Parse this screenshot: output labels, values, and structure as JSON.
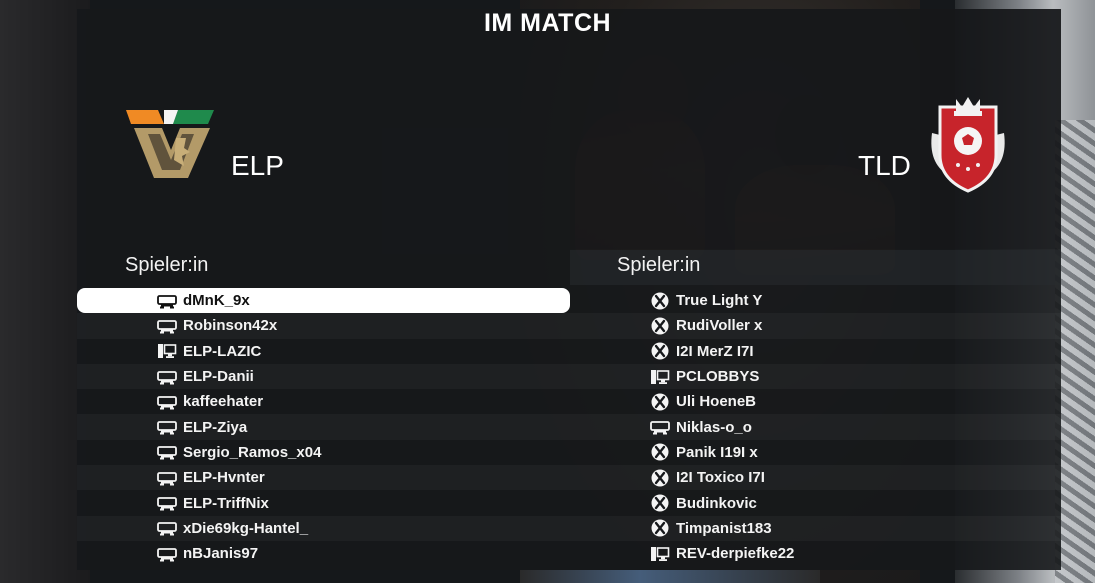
{
  "screen": {
    "title": "IM MATCH"
  },
  "home": {
    "name": "ELP",
    "logo_icon": "venezia-v-lion-crest-icon",
    "list_header": "Spieler:in",
    "players": [
      {
        "name": "dMnK_9x",
        "platform": "playstation-icon",
        "selected": true
      },
      {
        "name": "Robinson42x",
        "platform": "playstation-icon"
      },
      {
        "name": "ELP-LAZIC",
        "platform": "pc-icon"
      },
      {
        "name": "ELP-Danii",
        "platform": "playstation-icon"
      },
      {
        "name": "kaffeehater",
        "platform": "playstation-icon"
      },
      {
        "name": "ELP-Ziya",
        "platform": "playstation-icon"
      },
      {
        "name": "Sergio_Ramos_x04",
        "platform": "playstation-icon"
      },
      {
        "name": "ELP-Hvnter",
        "platform": "playstation-icon"
      },
      {
        "name": "ELP-TriffNix",
        "platform": "playstation-icon"
      },
      {
        "name": "xDie69kg-Hantel_",
        "platform": "playstation-icon"
      },
      {
        "name": "nBJanis97",
        "platform": "playstation-icon"
      }
    ]
  },
  "away": {
    "name": "TLD",
    "logo_icon": "red-shield-football-crest-icon",
    "list_header": "Spieler:in",
    "players": [
      {
        "name": "True Light Y",
        "platform": "xbox-icon"
      },
      {
        "name": "RudiVoller x",
        "platform": "xbox-icon"
      },
      {
        "name": "I2I MerZ I7I",
        "platform": "xbox-icon"
      },
      {
        "name": "PCLOBBYS",
        "platform": "pc-icon"
      },
      {
        "name": "Uli HoeneB",
        "platform": "xbox-icon"
      },
      {
        "name": "Niklas-o_o",
        "platform": "playstation-icon"
      },
      {
        "name": "Panik I19I x",
        "platform": "xbox-icon"
      },
      {
        "name": "I2I Toxico I7I",
        "platform": "xbox-icon"
      },
      {
        "name": "Budinkovic",
        "platform": "xbox-icon"
      },
      {
        "name": "Timpanist183",
        "platform": "xbox-icon"
      },
      {
        "name": "REV-derpiefke22",
        "platform": "pc-icon"
      }
    ]
  },
  "colors": {
    "selected_row_bg": "#ffffff",
    "selected_row_text": "#111111",
    "text": "#f4f4f4",
    "panel_bg": "#16181b"
  }
}
